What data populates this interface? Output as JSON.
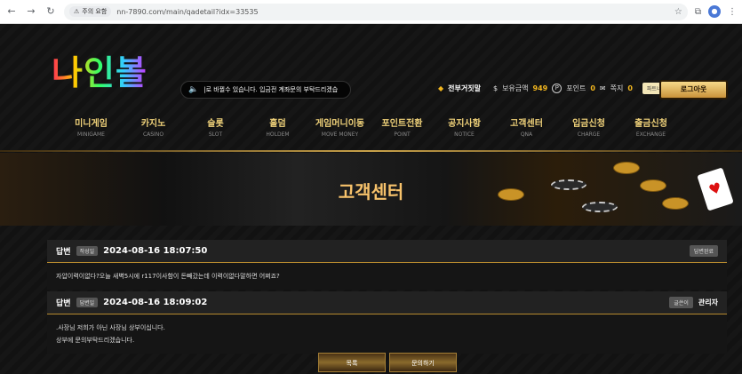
{
  "browser": {
    "warning": "주의 요함",
    "url": "nn-7890.com/main/qadetail?idx=33535"
  },
  "header": {
    "logo": "나인볼",
    "notice": "|로 바뀔수 있습니다. 입금전 계좌문의 부탁드리겠습",
    "user_name": "전부거짓말",
    "balance_label": "보유금액",
    "balance": "949",
    "point_label": "포인트",
    "point": "0",
    "message_label": "쪽지",
    "message": "0",
    "partner": "파트너",
    "logout": "로그아웃"
  },
  "nav": [
    {
      "ko": "미니게임",
      "en": "MINIGAME"
    },
    {
      "ko": "카지노",
      "en": "CASINO"
    },
    {
      "ko": "슬롯",
      "en": "SLOT"
    },
    {
      "ko": "홀덤",
      "en": "HOLDEM"
    },
    {
      "ko": "게임머니이동",
      "en": "MOVE MONEY"
    },
    {
      "ko": "포인트전환",
      "en": "POINT"
    },
    {
      "ko": "공지사항",
      "en": "NOTICE"
    },
    {
      "ko": "고객센터",
      "en": "QNA"
    },
    {
      "ko": "입금신청",
      "en": "CHARGE"
    },
    {
      "ko": "출금신청",
      "en": "EXCHANGE"
    }
  ],
  "banner": {
    "title": "고객센터"
  },
  "question": {
    "label": "답변",
    "tag": "작성일",
    "date": "2024-08-16 18:07:50",
    "status": "답변완료",
    "body": "자압이력이없다?오늘 새벽5시에 r117이사함이 돈빼갔는데 이력이없다말하면 어쩌죠?"
  },
  "answer": {
    "label": "답변",
    "tag": "답변일",
    "date": "2024-08-16 18:09:02",
    "badge": "글쓴이",
    "writer": "관리자",
    "line1": ".사장님 저희가 아닌 사장님 상부이십니다.",
    "line2": "상부에 문의부탁드리겠습니다."
  },
  "buttons": {
    "list": "목록",
    "inquire": "문의하기"
  }
}
